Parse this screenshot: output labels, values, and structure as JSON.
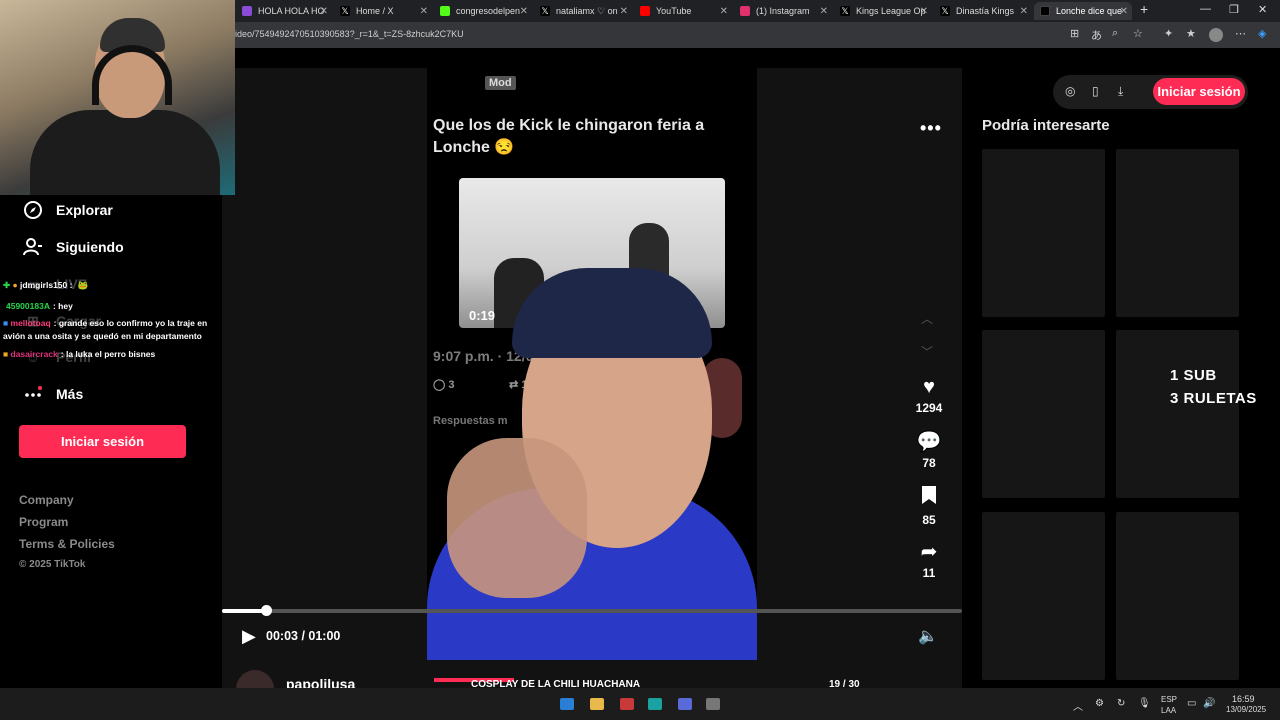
{
  "browser": {
    "tabs": [
      {
        "label": "HOLA HOLA HO",
        "color": "#8a4bd6",
        "active": false
      },
      {
        "label": "Home / X",
        "color": "#ffffff",
        "active": false
      },
      {
        "label": "congresodelpen",
        "color": "#53fc18",
        "active": false
      },
      {
        "label": "nataliamx ♡ on",
        "color": "#ffffff",
        "active": false
      },
      {
        "label": "YouTube",
        "color": "#ff0000",
        "active": false
      },
      {
        "label": "(1) Instagram",
        "color": "#e1306c",
        "active": false
      },
      {
        "label": "Kings League Op",
        "color": "#ffffff",
        "active": false
      },
      {
        "label": "Dinastía Kings",
        "color": "#ffffff",
        "active": false
      },
      {
        "label": "Lonche dice que",
        "color": "#ffffff",
        "active": true
      }
    ],
    "new_tab": "+",
    "url": "ideo/7549492470510390583?_r=1&_t=ZS-8zhcuk2C7KU"
  },
  "sidebar": {
    "items": [
      {
        "label": "Explorar",
        "icon": "compass-icon"
      },
      {
        "label": "Siguiendo",
        "icon": "user-follow-icon"
      },
      {
        "label": "LIVE",
        "icon": "live-icon"
      },
      {
        "label": "Cargar",
        "icon": "upload-icon"
      },
      {
        "label": "Perfil",
        "icon": "profile-icon"
      },
      {
        "label": "Más",
        "icon": "more-icon"
      }
    ],
    "login_label": "Iniciar sesión",
    "footer_links": [
      "Company",
      "Program",
      "Terms & Policies"
    ],
    "copyright": "© 2025 TikTok"
  },
  "chat": [
    {
      "user": "jdmgirls150 :",
      "msg": ""
    },
    {
      "user": "45900183A",
      "msg": ": hey"
    },
    {
      "user": "mellotoaq",
      "msg": ": grande eso lo confirmo yo la traje en"
    },
    {
      "user": "",
      "msg": "avión a una osita y se quedó en mi departamento"
    },
    {
      "user": "dasaircrack",
      "msg": ": la luka el perro bisnes"
    }
  ],
  "video": {
    "mod_badge": "Mod",
    "tweet_text": "Que los de Kick le chingaron feria a Lonche 😒",
    "media_time": "0:19",
    "tweet_date": "9:07 p.m. · 12/09/",
    "replies_count": "3",
    "retweet_count": "1",
    "replies_label": "Respuestas m",
    "current_time": "00:03 / 01:00",
    "progress": 0.06,
    "author": "papolilusa"
  },
  "actions": {
    "likes": "1294",
    "comments": "78",
    "saves": "85",
    "shares": "11"
  },
  "right": {
    "login_label": "Iniciar sesión",
    "title": "Podría interesarte",
    "overlay_line1": "1 SUB",
    "overlay_line2": "3 RULETAS"
  },
  "goal": {
    "label": "COSPLAY DE LA CHILI HUACHANA",
    "current": "19",
    "separator": "/",
    "target": "30",
    "progress": 0.633
  },
  "taskbar": {
    "lang1": "ESP",
    "lang2": "LAA",
    "time": "16:59",
    "date": "13/09/2025"
  }
}
